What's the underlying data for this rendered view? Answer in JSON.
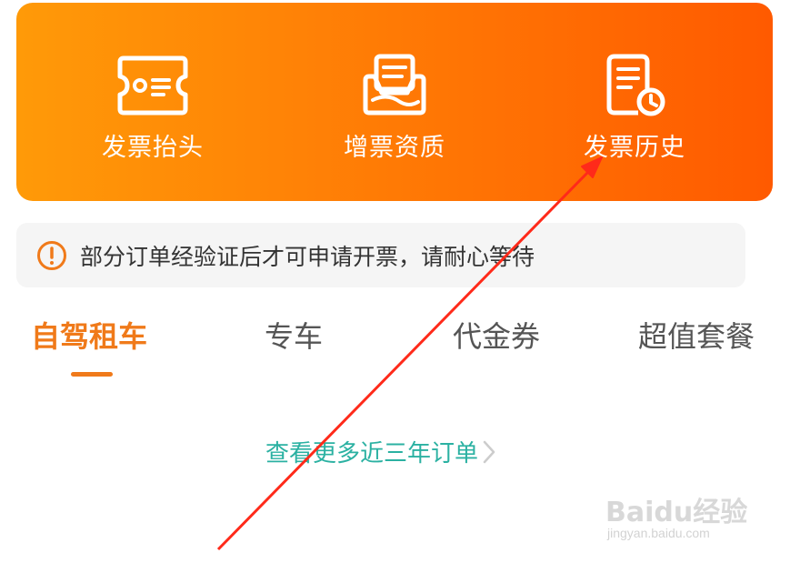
{
  "banner": {
    "items": [
      {
        "label": "发票抬头",
        "icon": "invoice-title-icon"
      },
      {
        "label": "增票资质",
        "icon": "vat-qualification-icon"
      },
      {
        "label": "发票历史",
        "icon": "invoice-history-icon"
      }
    ]
  },
  "notice": {
    "icon": "warning-circle-icon",
    "text": "部分订单经验证后才可申请开票，请耐心等待"
  },
  "tabs": [
    "自驾租车",
    "专车",
    "代金券",
    "超值套餐"
  ],
  "active_tab": 0,
  "more_link": {
    "label": "查看更多近三年订单",
    "icon": "chevron-right-icon"
  },
  "watermark": {
    "logo": "Baidu经验",
    "url": "jingyan.baidu.com"
  },
  "colors": {
    "banner_start": "#ff9a08",
    "banner_end": "#ff5a00",
    "accent": "#f07a1a",
    "link": "#2bb1a2",
    "annotation_arrow": "#ff2a1a"
  }
}
